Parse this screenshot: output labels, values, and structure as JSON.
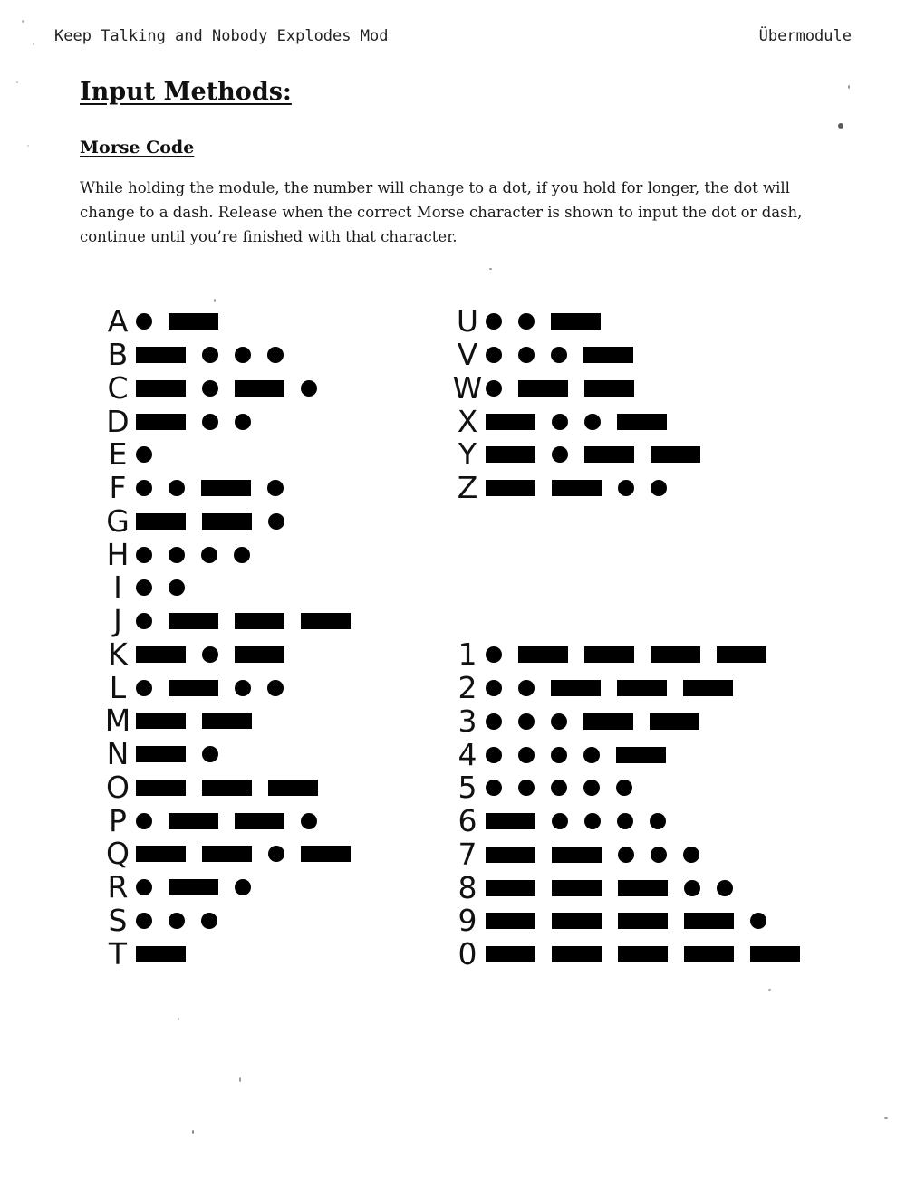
{
  "header": {
    "left": "Keep Talking and Nobody Explodes Mod",
    "right": "Übermodule"
  },
  "page_title": "Input Methods:",
  "section": {
    "title": "Morse Code",
    "body": "While holding the module, the number will change to a dot, if you hold for longer, the dot will change to a dash. Release when the correct Morse character is shown to input the dot or dash, continue until you’re finished with that character."
  },
  "morse": {
    "letters_col1": [
      {
        "char": "A",
        "code": ".-"
      },
      {
        "char": "B",
        "code": "-..."
      },
      {
        "char": "C",
        "code": "-.-."
      },
      {
        "char": "D",
        "code": "-.."
      },
      {
        "char": "E",
        "code": "."
      },
      {
        "char": "F",
        "code": "..-."
      },
      {
        "char": "G",
        "code": "--."
      },
      {
        "char": "H",
        "code": "...."
      },
      {
        "char": "I",
        "code": ".."
      },
      {
        "char": "J",
        "code": ".---"
      },
      {
        "char": "K",
        "code": "-.-"
      },
      {
        "char": "L",
        "code": ".-.."
      },
      {
        "char": "M",
        "code": "--"
      },
      {
        "char": "N",
        "code": "-."
      },
      {
        "char": "O",
        "code": "---"
      },
      {
        "char": "P",
        "code": ".--."
      },
      {
        "char": "Q",
        "code": "--.-"
      },
      {
        "char": "R",
        "code": ".-."
      },
      {
        "char": "S",
        "code": "..."
      },
      {
        "char": "T",
        "code": "-"
      }
    ],
    "letters_col2": [
      {
        "char": "U",
        "code": "..-"
      },
      {
        "char": "V",
        "code": "...-"
      },
      {
        "char": "W",
        "code": ".--"
      },
      {
        "char": "X",
        "code": "-..-"
      },
      {
        "char": "Y",
        "code": "-.--"
      },
      {
        "char": "Z",
        "code": "--.."
      }
    ],
    "digits": [
      {
        "char": "1",
        "code": ".----"
      },
      {
        "char": "2",
        "code": "..---"
      },
      {
        "char": "3",
        "code": "...--"
      },
      {
        "char": "4",
        "code": "....-"
      },
      {
        "char": "5",
        "code": "....."
      },
      {
        "char": "6",
        "code": "-...."
      },
      {
        "char": "7",
        "code": "--..."
      },
      {
        "char": "8",
        "code": "---.."
      },
      {
        "char": "9",
        "code": "----."
      },
      {
        "char": "0",
        "code": "-----"
      }
    ]
  }
}
